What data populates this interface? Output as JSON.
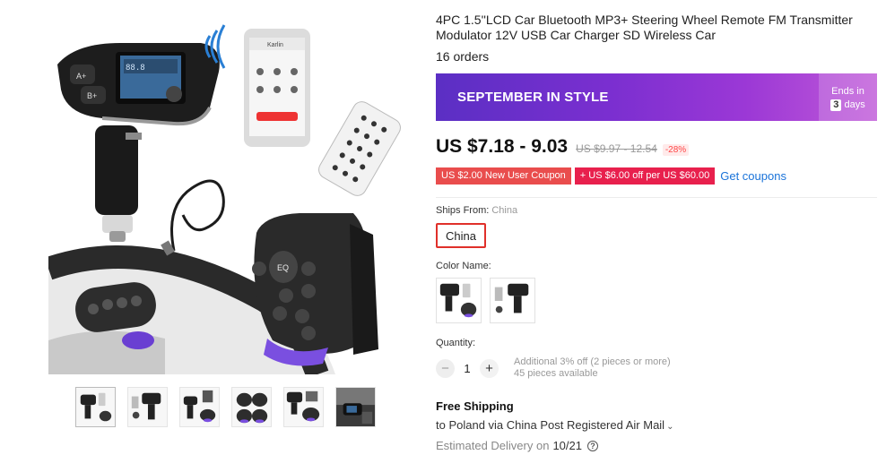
{
  "product": {
    "title": "4PC 1.5''LCD Car Bluetooth MP3+ Steering Wheel Remote FM Transmitter Modulator 12V USB Car Charger SD Wireless Car",
    "orders": "16 orders"
  },
  "banner": {
    "title": "SEPTEMBER IN STYLE",
    "ends_in": "Ends in",
    "days_num": "3",
    "days_label": "days"
  },
  "price": {
    "current": "US $7.18 - 9.03",
    "original": "US $9.97 - 12.54",
    "discount": "-28%"
  },
  "coupons": {
    "new_user": "US $2.00 New User Coupon",
    "store": "US $6.00 off per US $60.00",
    "get_link": "Get coupons"
  },
  "shipping_from": {
    "label": "Ships From:",
    "value": "China",
    "option": "China"
  },
  "color": {
    "label": "Color Name:"
  },
  "quantity": {
    "label": "Quantity:",
    "minus": "−",
    "plus": "+",
    "value": "1",
    "note_line1": "Additional 3% off (2 pieces or more)",
    "note_line2": "45 pieces available"
  },
  "shipping": {
    "title": "Free Shipping",
    "to": "to Poland via China Post Registered Air Mail",
    "chevron": "⌄",
    "delivery_label": "Estimated Delivery on",
    "delivery_date": "10/21",
    "help": "?"
  },
  "icons": {
    "help": "question-circle-icon",
    "chevron": "chevron-down-icon",
    "coupon_plus": "plus-icon"
  },
  "colors": {
    "banner_start": "#5b2fc4",
    "banner_end": "#c059d8",
    "price_accent": "#ff4747",
    "coupon_red": "#e94d4d",
    "link_blue": "#1a73d9",
    "selected_border": "#e0302a"
  }
}
